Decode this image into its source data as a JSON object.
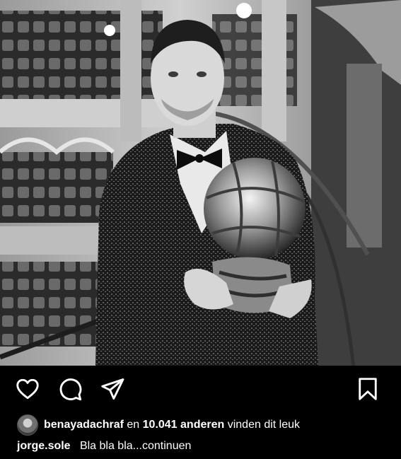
{
  "post": {
    "photo": {
      "subject": "Man in sequined tuxedo holding golden ball trophy in theatre balcony"
    },
    "actions": {
      "like_icon": "heart-icon",
      "comment_icon": "comment-bubble-icon",
      "share_icon": "paper-plane-icon",
      "save_icon": "bookmark-icon"
    },
    "likes": {
      "user": "benayadachraf",
      "connector": "en",
      "count": "10.041 anderen",
      "suffix": "vinden dit leuk"
    },
    "caption": {
      "user": "jorge.sole",
      "text": "Bla bla bla...continuen"
    }
  },
  "colors": {
    "background": "#000000",
    "text": "#ffffff"
  }
}
